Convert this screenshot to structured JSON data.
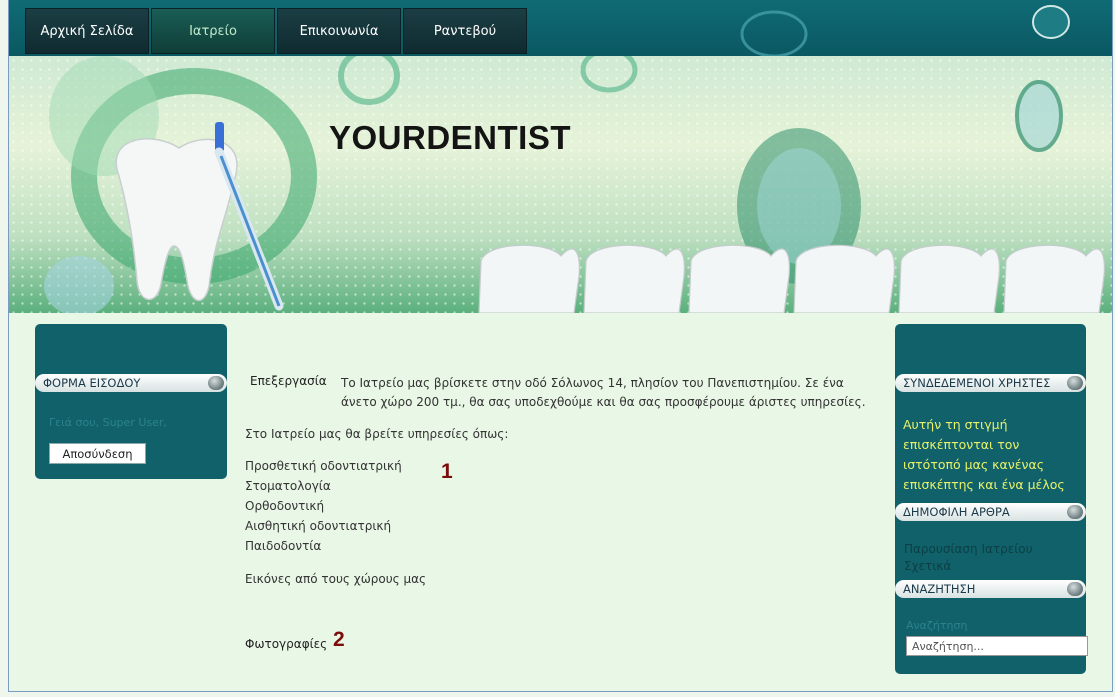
{
  "nav": {
    "items": [
      "Αρχική Σελίδα",
      "Ιατρείο",
      "Επικοινωνία",
      "Ραντεβού"
    ],
    "active": "Ιατρείο"
  },
  "banner": {
    "title": "YOURDENTIST"
  },
  "left_sidebar": {
    "login_module_title": "ΦΟΡΜΑ ΕΙΣΟΔΟΥ",
    "greeting": "Γειά σου, Super User,",
    "logout_label": "Αποσύνδεση"
  },
  "article": {
    "edit_label": "Επεξεργασία",
    "intro": "Το Ιατρείο μας βρίσκετε στην οδό Σόλωνος 14, πλησίον του Πανεπιστημίου. Σε ένα άνετο χώρο 200 τμ., θα σας υποδεχθούμε και θα σας προσφέρουμε άριστες υπηρεσίες.",
    "services_heading": "Στο Ιατρείο μας θα βρείτε υπηρεσίες όπως:",
    "services": [
      "Προσθετική οδοντιατρική",
      "Στοματολογία",
      "Ορθοδοντική",
      "Αισθητική οδοντιατρική",
      "Παιδοδοντία"
    ],
    "images_heading": "Εικόνες από τους χώρους μας",
    "photos_link": "Φωτογραφίες",
    "marker_1": "1",
    "marker_2": "2"
  },
  "right_sidebar": {
    "online_title": "ΣΥΝΔΕΔΕΜΕΝΟΙ ΧΡΗΣΤΕΣ",
    "online_text": "Αυτήν τη στιγμή επισκέπτονται τον ιστότοπό μας κανένας επισκέπτης και ένα μέλος",
    "popular_title": "ΔΗΜΟΦΙΛΗ ΑΡΘΡΑ",
    "popular_links": [
      "Παρουσίαση Ιατρείου",
      "Σχετικά"
    ],
    "search_title": "ΑΝΑΖΗΤΗΣΗ",
    "search_label": "Αναζήτηση",
    "search_placeholder": "Αναζήτηση..."
  },
  "colors": {
    "panel": "#10616a",
    "page_bg": "#e9f7e6",
    "marker": "#7a0c0c",
    "online_text": "#e8f26a"
  }
}
